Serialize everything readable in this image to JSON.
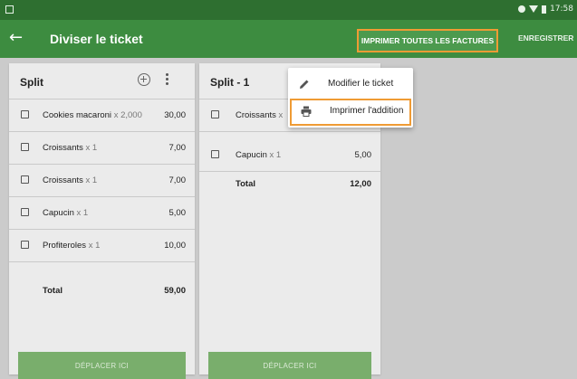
{
  "status": {
    "time": "17:58"
  },
  "appbar": {
    "title": "Diviser le ticket",
    "print_all_label": "IMPRIMER TOUTES LES FACTURES",
    "save_label": "ENREGISTRER"
  },
  "split_main": {
    "title": "Split",
    "items": [
      {
        "name": "Cookies macaroni",
        "qty": "x 2,000",
        "price": "30,00"
      },
      {
        "name": "Croissants",
        "qty": "x 1",
        "price": "7,00"
      },
      {
        "name": "Croissants",
        "qty": "x 1",
        "price": "7,00"
      },
      {
        "name": "Capucin",
        "qty": "x 1",
        "price": "5,00"
      },
      {
        "name": "Profiteroles",
        "qty": "x 1",
        "price": "10,00"
      }
    ],
    "total_label": "Total",
    "total_value": "59,00",
    "move_label": "DÉPLACER ICI"
  },
  "split_1": {
    "title": "Split - 1",
    "items": [
      {
        "name": "Croissants",
        "qty": "x",
        "price": ""
      },
      {
        "name": "Capucin",
        "qty": "x 1",
        "price": "5,00"
      }
    ],
    "total_label": "Total",
    "total_value": "12,00",
    "move_label": "DÉPLACER ICI"
  },
  "menu": {
    "items": [
      {
        "label": "Modifier le ticket",
        "icon": "pencil-icon"
      },
      {
        "label": "Imprimer l'addition",
        "icon": "printer-icon"
      }
    ]
  },
  "colors": {
    "status_bar": "#2e6f30",
    "app_bar": "#3d8c40",
    "highlight": "#ef9b34",
    "move_button": "#79ae6c",
    "background": "#cbcbcb"
  }
}
